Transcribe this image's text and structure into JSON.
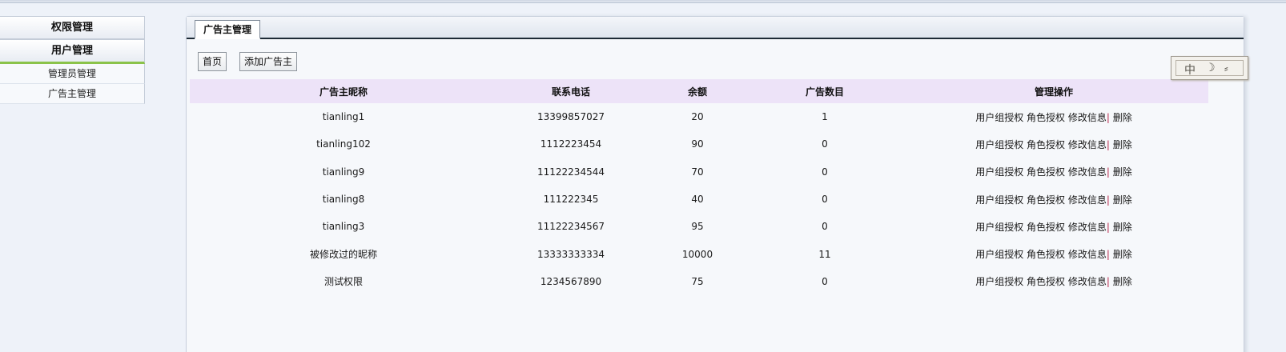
{
  "sidebar": {
    "sections": [
      {
        "label": "权限管理"
      },
      {
        "label": "用户管理"
      }
    ],
    "items": [
      {
        "label": "管理员管理"
      },
      {
        "label": "广告主管理"
      }
    ]
  },
  "panel": {
    "tab_label": "广告主管理",
    "toolbar": {
      "home_label": "首页",
      "add_label": "添加广告主"
    }
  },
  "table": {
    "headers": [
      "广告主昵称",
      "联系电话",
      "余额",
      "广告数目",
      "管理操作"
    ],
    "actions": {
      "user_group": "用户组授权",
      "role": "角色授权",
      "edit": "修改信息",
      "sep": "|",
      "delete": "删除"
    },
    "rows": [
      {
        "name": "tianling1",
        "phone": "13399857027",
        "balance": "20",
        "ads": "1"
      },
      {
        "name": "tianling102",
        "phone": "1112223454",
        "balance": "90",
        "ads": "0"
      },
      {
        "name": "tianling9",
        "phone": "11122234544",
        "balance": "70",
        "ads": "0"
      },
      {
        "name": "tianling8",
        "phone": "111222345",
        "balance": "40",
        "ads": "0"
      },
      {
        "name": "tianling3",
        "phone": "11122234567",
        "balance": "95",
        "ads": "0"
      },
      {
        "name": "被修改过的昵称",
        "phone": "13333333334",
        "balance": "10000",
        "ads": "11"
      },
      {
        "name": "测试权限",
        "phone": "1234567890",
        "balance": "75",
        "ads": "0"
      }
    ]
  },
  "ime": {
    "mode": "中",
    "punct": "☽",
    "width": "⸗"
  }
}
